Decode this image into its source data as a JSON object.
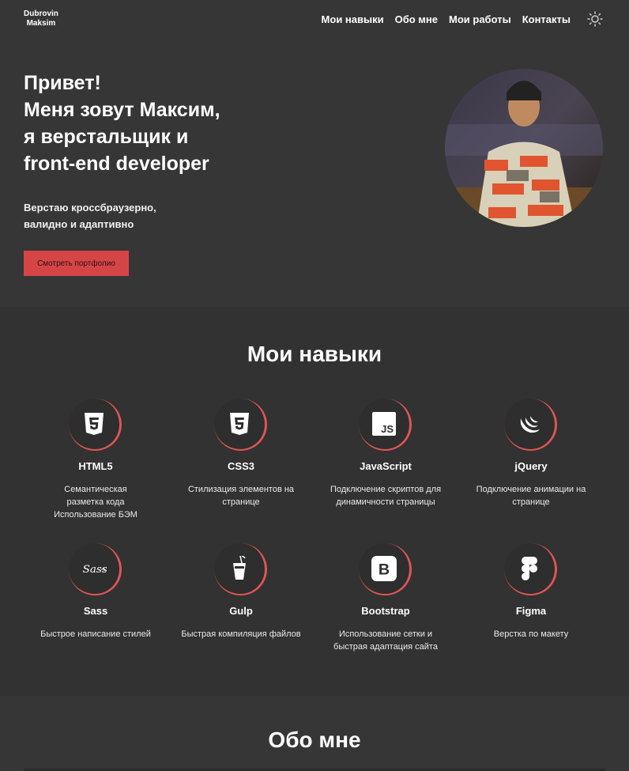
{
  "header": {
    "logo_line1": "Dubrovin",
    "logo_line2": "Maksim",
    "nav": [
      "Мои навыки",
      "Обо мне",
      "Мои работы",
      "Контакты"
    ],
    "theme_icon": "sun-icon"
  },
  "hero": {
    "heading_lines": [
      "Привет!",
      "Меня зовут Максим,",
      "я верстальщик и",
      "front-end developer"
    ],
    "subtitle_lines": [
      "Верстаю кроссбраузерно,",
      "валидно и адаптивно"
    ],
    "button_label": "Смотреть портфолио",
    "accent_color": "#d64545"
  },
  "skills": {
    "title": "Мои навыки",
    "items": [
      {
        "name": "HTML5",
        "icon": "html5-icon",
        "desc": [
          "Семантическая",
          "разметка кода",
          "Использование БЭМ"
        ]
      },
      {
        "name": "CSS3",
        "icon": "css3-icon",
        "desc": [
          "Стилизация элементов на",
          "странице"
        ]
      },
      {
        "name": "JavaScript",
        "icon": "javascript-icon",
        "desc": [
          "Подключение скриптов для",
          "динамичности страницы"
        ]
      },
      {
        "name": "jQuery",
        "icon": "jquery-icon",
        "desc": [
          "Подключение анимации на",
          "странице"
        ]
      },
      {
        "name": "Sass",
        "icon": "sass-icon",
        "desc": [
          "Быстрое написание стилей"
        ]
      },
      {
        "name": "Gulp",
        "icon": "gulp-icon",
        "desc": [
          "Быстрая компиляция файлов"
        ]
      },
      {
        "name": "Bootstrap",
        "icon": "bootstrap-icon",
        "desc": [
          "Использование сетки и",
          "быстрая адаптация сайта"
        ]
      },
      {
        "name": "Figma",
        "icon": "figma-icon",
        "desc": [
          "Верстка по макету"
        ]
      }
    ]
  },
  "about": {
    "title": "Обо мне"
  }
}
